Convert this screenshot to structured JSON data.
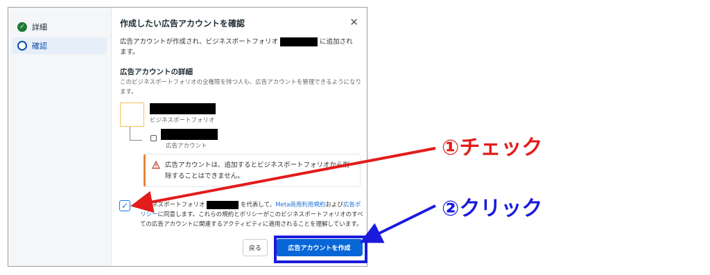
{
  "sidebar": {
    "steps": [
      {
        "label": "詳細",
        "state": "done"
      },
      {
        "label": "確認",
        "state": "active"
      }
    ]
  },
  "dialog": {
    "title": "作成したい広告アカウントを確認",
    "intro_prefix": "広告アカウントが作成され、ビジネスポートフォリオ",
    "intro_suffix_1": "に追加され",
    "intro_suffix_2": "ます。",
    "details_heading": "広告アカウントの詳細",
    "details_note": "このビジネスポートフォリオの全権限を持つ人も、広告アカウントを管理できるようになります。",
    "portfolio_caption": "ビジネスポートフォリオ",
    "account_caption": "広告アカウント",
    "warning_line1": "広告アカウントは、追加するとビジネスポートフォリオから削",
    "warning_line2": "除することはできません。",
    "agree_prefix": "ビジネスポートフォリオ",
    "agree_mid": "を代表して、",
    "agree_link1": "Meta商用利用規約",
    "agree_and": "および",
    "agree_link2": "広告ポリシー",
    "agree_rest": "に同意します。これらの規約とポリシーがこのビジネスポートフォリオのすべての広告アカウントに関連するアクティビティに適用されることを理解しています。",
    "back_label": "戻る",
    "create_label": "広告アカウントを作成"
  },
  "annotations": {
    "step1": "①チェック",
    "step2": "②クリック",
    "color1": "#e31b1b",
    "color2": "#1a1bdc"
  }
}
